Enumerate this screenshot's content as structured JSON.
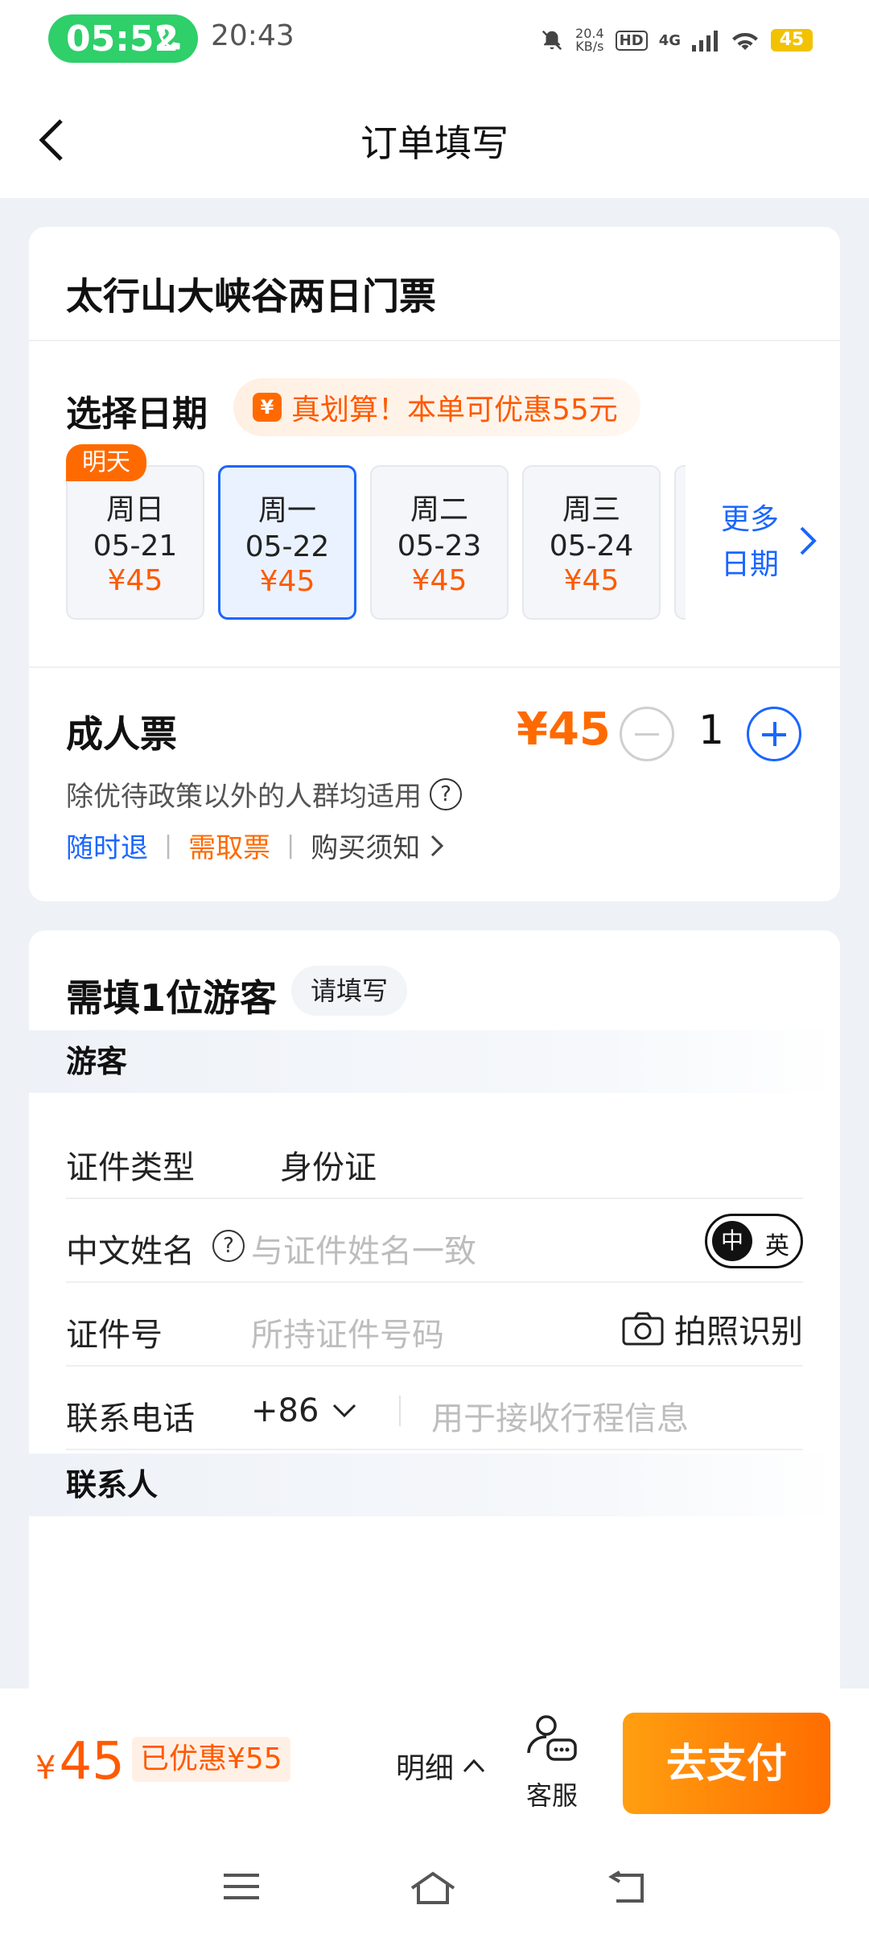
{
  "status_bar": {
    "call_timer": "05:52",
    "time": "20:43",
    "net_speed_value": "20.4",
    "net_speed_unit": "KB/s",
    "hd": "HD",
    "network": "4G",
    "battery": "45"
  },
  "nav": {
    "title": "订单填写"
  },
  "product": {
    "title": "太行山大峡谷两日门票"
  },
  "date_section": {
    "label": "选择日期",
    "promo": "真划算！本单可优惠55元",
    "promo_icon": "¥",
    "tomorrow_tag": "明天",
    "dates": [
      {
        "weekday": "周日",
        "date": "05-21",
        "price": "¥45"
      },
      {
        "weekday": "周一",
        "date": "05-22",
        "price": "¥45"
      },
      {
        "weekday": "周二",
        "date": "05-23",
        "price": "¥45"
      },
      {
        "weekday": "周三",
        "date": "05-24",
        "price": "¥45"
      }
    ],
    "more_line1": "更多",
    "more_line2": "日期"
  },
  "ticket": {
    "name": "成人票",
    "price": "¥45",
    "quantity": "1",
    "description": "除优待政策以外的人群均适用",
    "help": "?",
    "tag_refund": "随时退",
    "tag_pickup": "需取票",
    "tag_notice": "购买须知",
    "separator": "|"
  },
  "visitor": {
    "title": "需填1位游客",
    "badge": "请填写",
    "section_visitor": "游客",
    "id_type_label": "证件类型",
    "id_type_value": "身份证",
    "name_label": "中文姓名",
    "name_help": "?",
    "name_placeholder": "与证件姓名一致",
    "lang_on": "中",
    "lang_off": "英",
    "id_no_label": "证件号",
    "id_no_placeholder": "所持证件号码",
    "photo_label": "拍照识别",
    "phone_label": "联系电话",
    "phone_code": "+86",
    "phone_placeholder": "用于接收行程信息",
    "section_contact": "联系人"
  },
  "bottom": {
    "currency": "¥",
    "total": "45",
    "saved": "已优惠¥55",
    "detail": "明细",
    "service": "客服",
    "pay": "去支付"
  },
  "colors": {
    "accent_blue": "#1a66ff",
    "accent_orange": "#ff6a00",
    "call_green": "#2fcf6a"
  }
}
